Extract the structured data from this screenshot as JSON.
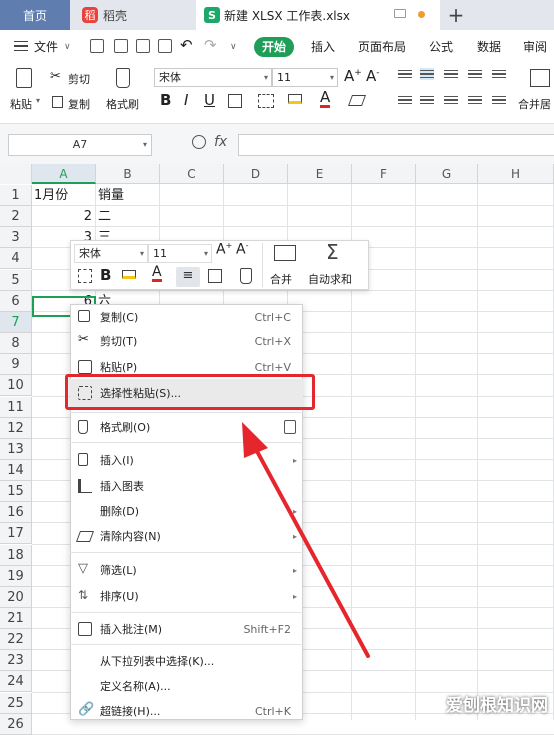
{
  "tabs": {
    "home": "首页",
    "daoke_logo": "稻",
    "daoke": "稻壳",
    "doc_logo": "S",
    "doc": "新建 XLSX 工作表.xlsx",
    "add": "+"
  },
  "menu": {
    "file": "文件",
    "start": "开始",
    "insert": "插入",
    "layout": "页面布局",
    "formula": "公式",
    "data": "数据",
    "review": "审阅"
  },
  "ribbon": {
    "cut": "剪切",
    "paste": "粘贴",
    "copy": "复制",
    "format_painter": "格式刷",
    "font_name": "宋体",
    "font_size": "11",
    "merge": "合并居"
  },
  "formula_bar": {
    "name_box": "A7",
    "fx": "fx"
  },
  "grid": {
    "columns": [
      "A",
      "B",
      "C",
      "D",
      "E",
      "F",
      "G",
      "H"
    ],
    "rows": [
      "1",
      "2",
      "3",
      "4",
      "5",
      "6",
      "7",
      "8",
      "9",
      "10",
      "11",
      "12",
      "13",
      "14",
      "15",
      "16",
      "17",
      "18",
      "19",
      "20",
      "21",
      "22",
      "23",
      "24",
      "25",
      "26"
    ],
    "cells": {
      "A1": "1月份",
      "B1": "销量",
      "A2": "2",
      "B2": "二",
      "A3": "3",
      "B3": "三",
      "A6": "6",
      "B6": "六"
    }
  },
  "mini_toolbar": {
    "font_name": "宋体",
    "font_size": "11",
    "merge": "合并",
    "autosum": "自动求和"
  },
  "context_menu": {
    "items": [
      {
        "label": "复制(C)",
        "shortcut": "Ctrl+C"
      },
      {
        "label": "剪切(T)",
        "shortcut": "Ctrl+X"
      },
      {
        "label": "粘贴(P)",
        "shortcut": "Ctrl+V"
      },
      {
        "label": "选择性粘贴(S)..."
      },
      {
        "label": "格式刷(O)"
      },
      {
        "label": "插入(I)"
      },
      {
        "label": "插入图表"
      },
      {
        "label": "删除(D)"
      },
      {
        "label": "清除内容(N)"
      },
      {
        "label": "筛选(L)"
      },
      {
        "label": "排序(U)"
      },
      {
        "label": "插入批注(M)",
        "shortcut": "Shift+F2"
      },
      {
        "label": "从下拉列表中选择(K)..."
      },
      {
        "label": "定义名称(A)..."
      },
      {
        "label": "超链接(H)...",
        "shortcut": "Ctrl+K"
      }
    ]
  },
  "watermark": "爱刨根知识网",
  "colors": {
    "accent": "#1e9e57",
    "highlight": "#e5262c",
    "selection": "#1e9e57"
  }
}
